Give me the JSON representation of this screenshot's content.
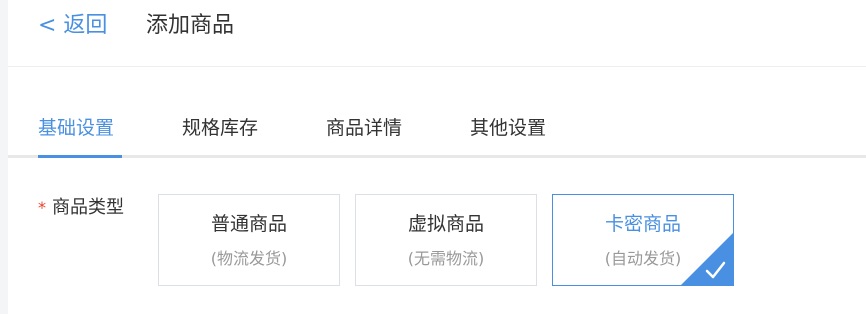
{
  "header": {
    "back_label": "< 返回",
    "title": "添加商品"
  },
  "tabs": [
    {
      "label": "基础设置",
      "active": true
    },
    {
      "label": "规格库存",
      "active": false
    },
    {
      "label": "商品详情",
      "active": false
    },
    {
      "label": "其他设置",
      "active": false
    }
  ],
  "form": {
    "product_type": {
      "required_mark": "*",
      "label": "商品类型",
      "options": [
        {
          "title": "普通商品",
          "subtitle": "(物流发货)",
          "selected": false
        },
        {
          "title": "虚拟商品",
          "subtitle": "(无需物流)",
          "selected": false
        },
        {
          "title": "卡密商品",
          "subtitle": "(自动发货)",
          "selected": true
        }
      ],
      "selected_icon": "checkmark-icon"
    }
  },
  "colors": {
    "accent": "#4a90e2",
    "required": "#e8412c",
    "text": "#333333",
    "muted": "#999999"
  }
}
